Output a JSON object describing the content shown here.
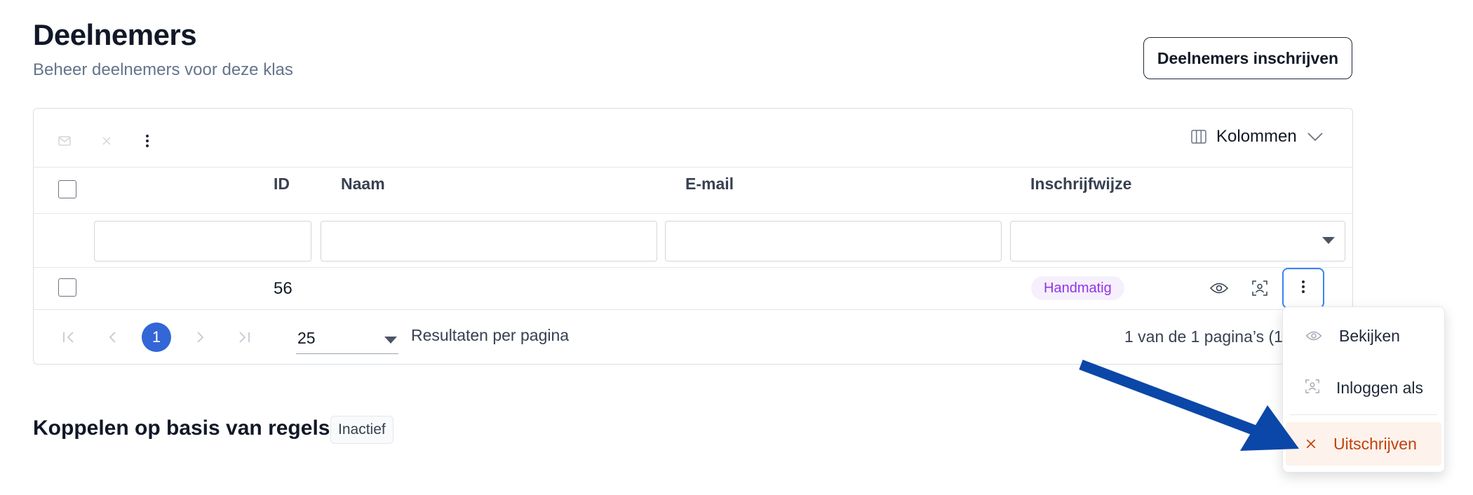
{
  "header": {
    "title": "Deelnemers",
    "subtitle": "Beheer deelnemers voor deze klas",
    "enroll_button": "Deelnemers inschrijven"
  },
  "toolbar": {
    "icons": [
      "mail-icon",
      "close-icon",
      "more-vertical-icon"
    ],
    "columns_button": "Kolommen"
  },
  "table": {
    "columns": [
      "ID",
      "Naam",
      "E-mail",
      "Inschrijfwijze"
    ],
    "rows": [
      {
        "id": "56",
        "naam": "",
        "email": "",
        "inschrijfwijze": "Handmatig"
      }
    ],
    "row_action_icons": [
      "eye-icon",
      "user-scan-icon",
      "more-vertical-icon"
    ]
  },
  "pagination": {
    "current_page": "1",
    "per_page": "25",
    "per_page_label": "Resultaten per pagina",
    "page_info": "1 van de 1 pagina’s (1"
  },
  "dropdown": {
    "items": [
      {
        "label": "Bekijken",
        "icon": "eye-icon"
      },
      {
        "label": "Inloggen als",
        "icon": "user-scan-icon"
      },
      {
        "label": "Uitschrijven",
        "icon": "close-icon"
      }
    ]
  },
  "section": {
    "title": "Koppelen op basis van regels",
    "status": "Inactief"
  },
  "colors": {
    "accent": "#3366d6",
    "badge_text": "#9333ea",
    "danger_text": "#c2410c",
    "annotation_arrow": "#0b47a8"
  }
}
